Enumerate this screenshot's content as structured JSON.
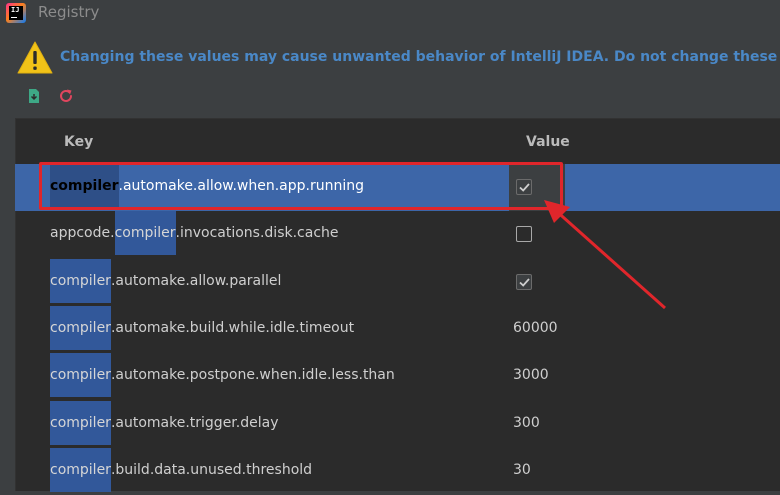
{
  "window": {
    "title": "Registry",
    "logo_text": "IJ"
  },
  "warning": {
    "icon": "warning-icon",
    "text": "Changing these values may cause unwanted behavior of IntelliJ IDEA. Do not change these unless you have been asked."
  },
  "toolbar": {
    "export_icon": "export-icon",
    "reset_icon": "reset-icon"
  },
  "table": {
    "headers": {
      "key": "Key",
      "value": "Value"
    },
    "rows": [
      {
        "prefix": "",
        "match": "compiler",
        "suffix": ".automake.allow.when.app.running",
        "value_type": "checkbox",
        "checked": true,
        "selected": true
      },
      {
        "prefix": "appcode.",
        "match": "compiler",
        "suffix": ".invocations.disk.cache",
        "value_type": "checkbox",
        "checked": false,
        "selected": false
      },
      {
        "prefix": "",
        "match": "compiler",
        "suffix": ".automake.allow.parallel",
        "value_type": "checkbox",
        "checked": true,
        "selected": false
      },
      {
        "prefix": "",
        "match": "compiler",
        "suffix": ".automake.build.while.idle.timeout",
        "value_type": "text",
        "value": "60000",
        "selected": false
      },
      {
        "prefix": "",
        "match": "compiler",
        "suffix": ".automake.postpone.when.idle.less.than",
        "value_type": "text",
        "value": "3000",
        "selected": false
      },
      {
        "prefix": "",
        "match": "compiler",
        "suffix": ".automake.trigger.delay",
        "value_type": "text",
        "value": "300",
        "selected": false
      },
      {
        "prefix": "",
        "match": "compiler",
        "suffix": ".build.data.unused.threshold",
        "value_type": "text",
        "value": "30",
        "selected": false
      }
    ]
  },
  "colors": {
    "annotation": "#e0262b",
    "selection": "#3d66a8",
    "match_highlight": "#32589a",
    "warning_text": "#4a88c7"
  }
}
